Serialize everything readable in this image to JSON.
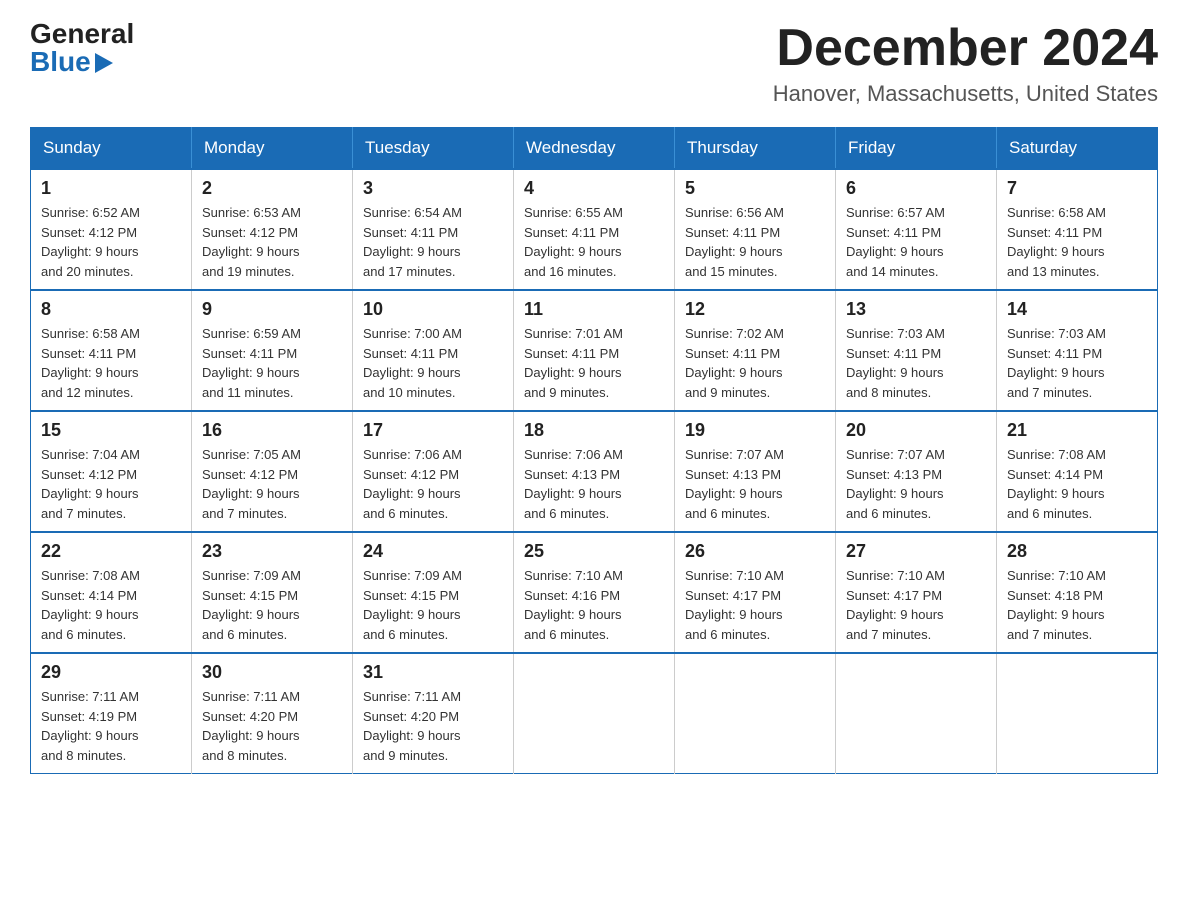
{
  "logo": {
    "general": "General",
    "blue": "Blue"
  },
  "title": "December 2024",
  "location": "Hanover, Massachusetts, United States",
  "days_of_week": [
    "Sunday",
    "Monday",
    "Tuesday",
    "Wednesday",
    "Thursday",
    "Friday",
    "Saturday"
  ],
  "weeks": [
    [
      {
        "day": "1",
        "sunrise": "6:52 AM",
        "sunset": "4:12 PM",
        "daylight": "9 hours and 20 minutes."
      },
      {
        "day": "2",
        "sunrise": "6:53 AM",
        "sunset": "4:12 PM",
        "daylight": "9 hours and 19 minutes."
      },
      {
        "day": "3",
        "sunrise": "6:54 AM",
        "sunset": "4:11 PM",
        "daylight": "9 hours and 17 minutes."
      },
      {
        "day": "4",
        "sunrise": "6:55 AM",
        "sunset": "4:11 PM",
        "daylight": "9 hours and 16 minutes."
      },
      {
        "day": "5",
        "sunrise": "6:56 AM",
        "sunset": "4:11 PM",
        "daylight": "9 hours and 15 minutes."
      },
      {
        "day": "6",
        "sunrise": "6:57 AM",
        "sunset": "4:11 PM",
        "daylight": "9 hours and 14 minutes."
      },
      {
        "day": "7",
        "sunrise": "6:58 AM",
        "sunset": "4:11 PM",
        "daylight": "9 hours and 13 minutes."
      }
    ],
    [
      {
        "day": "8",
        "sunrise": "6:58 AM",
        "sunset": "4:11 PM",
        "daylight": "9 hours and 12 minutes."
      },
      {
        "day": "9",
        "sunrise": "6:59 AM",
        "sunset": "4:11 PM",
        "daylight": "9 hours and 11 minutes."
      },
      {
        "day": "10",
        "sunrise": "7:00 AM",
        "sunset": "4:11 PM",
        "daylight": "9 hours and 10 minutes."
      },
      {
        "day": "11",
        "sunrise": "7:01 AM",
        "sunset": "4:11 PM",
        "daylight": "9 hours and 9 minutes."
      },
      {
        "day": "12",
        "sunrise": "7:02 AM",
        "sunset": "4:11 PM",
        "daylight": "9 hours and 9 minutes."
      },
      {
        "day": "13",
        "sunrise": "7:03 AM",
        "sunset": "4:11 PM",
        "daylight": "9 hours and 8 minutes."
      },
      {
        "day": "14",
        "sunrise": "7:03 AM",
        "sunset": "4:11 PM",
        "daylight": "9 hours and 7 minutes."
      }
    ],
    [
      {
        "day": "15",
        "sunrise": "7:04 AM",
        "sunset": "4:12 PM",
        "daylight": "9 hours and 7 minutes."
      },
      {
        "day": "16",
        "sunrise": "7:05 AM",
        "sunset": "4:12 PM",
        "daylight": "9 hours and 7 minutes."
      },
      {
        "day": "17",
        "sunrise": "7:06 AM",
        "sunset": "4:12 PM",
        "daylight": "9 hours and 6 minutes."
      },
      {
        "day": "18",
        "sunrise": "7:06 AM",
        "sunset": "4:13 PM",
        "daylight": "9 hours and 6 minutes."
      },
      {
        "day": "19",
        "sunrise": "7:07 AM",
        "sunset": "4:13 PM",
        "daylight": "9 hours and 6 minutes."
      },
      {
        "day": "20",
        "sunrise": "7:07 AM",
        "sunset": "4:13 PM",
        "daylight": "9 hours and 6 minutes."
      },
      {
        "day": "21",
        "sunrise": "7:08 AM",
        "sunset": "4:14 PM",
        "daylight": "9 hours and 6 minutes."
      }
    ],
    [
      {
        "day": "22",
        "sunrise": "7:08 AM",
        "sunset": "4:14 PM",
        "daylight": "9 hours and 6 minutes."
      },
      {
        "day": "23",
        "sunrise": "7:09 AM",
        "sunset": "4:15 PM",
        "daylight": "9 hours and 6 minutes."
      },
      {
        "day": "24",
        "sunrise": "7:09 AM",
        "sunset": "4:15 PM",
        "daylight": "9 hours and 6 minutes."
      },
      {
        "day": "25",
        "sunrise": "7:10 AM",
        "sunset": "4:16 PM",
        "daylight": "9 hours and 6 minutes."
      },
      {
        "day": "26",
        "sunrise": "7:10 AM",
        "sunset": "4:17 PM",
        "daylight": "9 hours and 6 minutes."
      },
      {
        "day": "27",
        "sunrise": "7:10 AM",
        "sunset": "4:17 PM",
        "daylight": "9 hours and 7 minutes."
      },
      {
        "day": "28",
        "sunrise": "7:10 AM",
        "sunset": "4:18 PM",
        "daylight": "9 hours and 7 minutes."
      }
    ],
    [
      {
        "day": "29",
        "sunrise": "7:11 AM",
        "sunset": "4:19 PM",
        "daylight": "9 hours and 8 minutes."
      },
      {
        "day": "30",
        "sunrise": "7:11 AM",
        "sunset": "4:20 PM",
        "daylight": "9 hours and 8 minutes."
      },
      {
        "day": "31",
        "sunrise": "7:11 AM",
        "sunset": "4:20 PM",
        "daylight": "9 hours and 9 minutes."
      },
      null,
      null,
      null,
      null
    ]
  ],
  "labels": {
    "sunrise": "Sunrise:",
    "sunset": "Sunset:",
    "daylight": "Daylight: 9 hours"
  }
}
